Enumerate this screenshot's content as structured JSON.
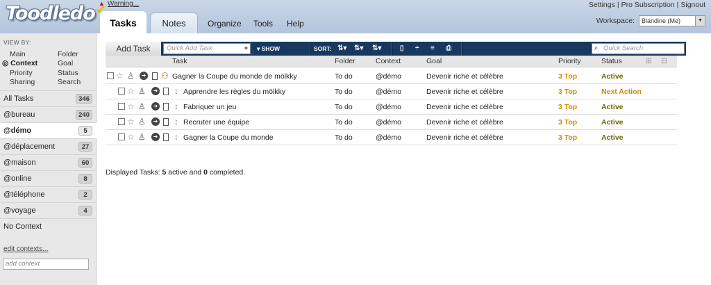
{
  "app": {
    "logo": "Toodledo",
    "warning": "Warning..."
  },
  "toplinks": [
    "Settings",
    "Pro Subscription",
    "Signout"
  ],
  "workspace": {
    "label": "Workspace:",
    "value": "Blandine (Me)"
  },
  "nav": {
    "tabs": [
      "Tasks",
      "Notes"
    ],
    "links": [
      "Organize",
      "Tools",
      "Help"
    ]
  },
  "sidebar": {
    "view_by_title": "VIEW BY:",
    "view_by": [
      "Main",
      "Folder",
      "Context",
      "Goal",
      "Priority",
      "Status",
      "Sharing",
      "Search"
    ],
    "contexts": [
      {
        "label": "All Tasks",
        "count": "346"
      },
      {
        "label": "@bureau",
        "count": "240"
      },
      {
        "label": "@démo",
        "count": "5"
      },
      {
        "label": "@déplacement",
        "count": "27"
      },
      {
        "label": "@maison",
        "count": "60"
      },
      {
        "label": "@online",
        "count": "8"
      },
      {
        "label": "@téléphone",
        "count": "2"
      },
      {
        "label": "@voyage",
        "count": "4"
      },
      {
        "label": "No Context",
        "count": ""
      }
    ],
    "edit_contexts": "edit contexts...",
    "add_context_placeholder": "add context"
  },
  "toolbar": {
    "add_task": "Add Task",
    "quick_add_placeholder": "Quick Add Task",
    "show": "SHOW",
    "sort": "SORT:",
    "quick_search_placeholder": "Quick Search"
  },
  "table": {
    "headers": [
      "Task",
      "Folder",
      "Context",
      "Goal",
      "Priority",
      "Status"
    ],
    "rows": [
      {
        "task": "Gagner la Coupe du monde de mölkky",
        "folder": "To do",
        "context": "@démo",
        "goal": "Devenir riche et célèbre",
        "priority": "3 Top",
        "status": "Active"
      },
      {
        "task": "Apprendre les règles du mölkky",
        "folder": "To do",
        "context": "@démo",
        "goal": "Devenir riche et célèbre",
        "priority": "3 Top",
        "status": "Next Action"
      },
      {
        "task": "Fabriquer un jeu",
        "folder": "To do",
        "context": "@démo",
        "goal": "Devenir riche et célèbre",
        "priority": "3 Top",
        "status": "Active"
      },
      {
        "task": "Recruter une équipe",
        "folder": "To do",
        "context": "@démo",
        "goal": "Devenir riche et célèbre",
        "priority": "3 Top",
        "status": "Active"
      },
      {
        "task": "Gagner la Coupe du monde",
        "folder": "To do",
        "context": "@démo",
        "goal": "Devenir riche et célèbre",
        "priority": "3 Top",
        "status": "Active"
      }
    ]
  },
  "summary": {
    "prefix": "Displayed Tasks: ",
    "active": "5",
    "mid": " active and ",
    "completed": "0",
    "suffix": " completed."
  }
}
